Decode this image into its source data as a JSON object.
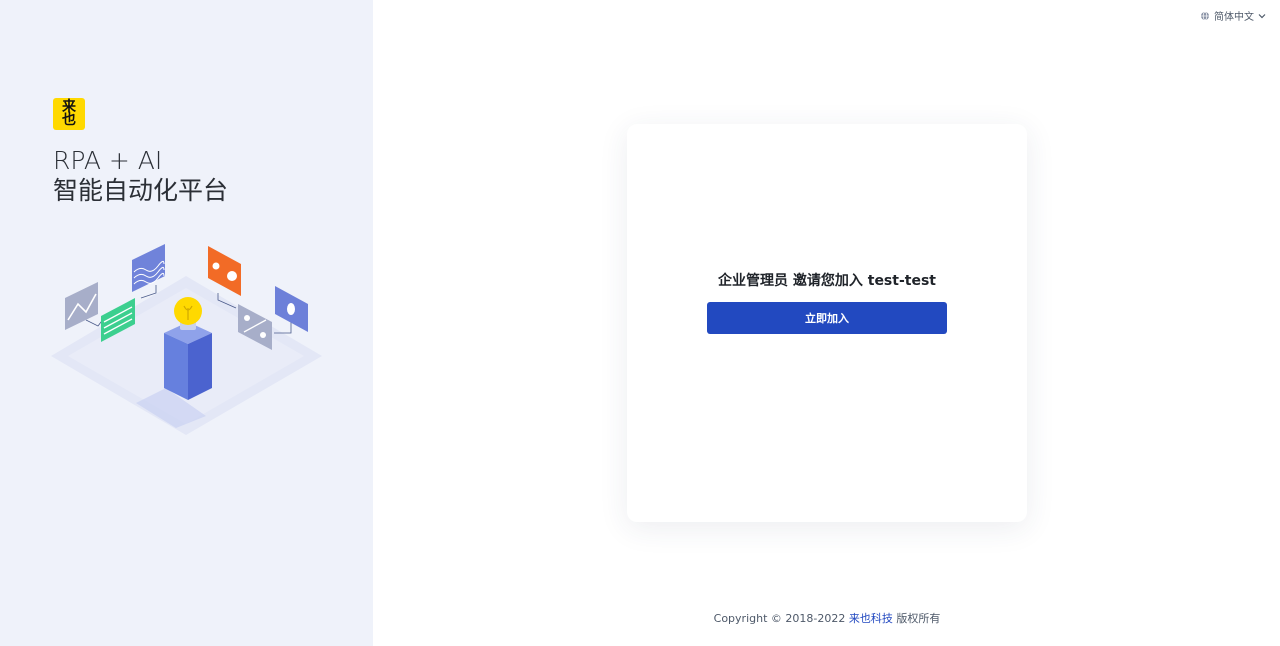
{
  "brand": {
    "logo_text": "来也",
    "slogan_line1": "RPA + AI",
    "slogan_line2": "智能自动化平台"
  },
  "header": {
    "language_label": "简体中文"
  },
  "invite": {
    "message": "企业管理员 邀请您加入 test-test",
    "join_button_label": "立即加入"
  },
  "footer": {
    "copyright_prefix": "Copyright © 2018-2022",
    "company_link": "来也科技",
    "copyright_suffix": "版权所有"
  },
  "colors": {
    "primary": "#2249c0",
    "left_panel_bg": "#eff2fa",
    "logo_yellow": "#ffd900"
  }
}
